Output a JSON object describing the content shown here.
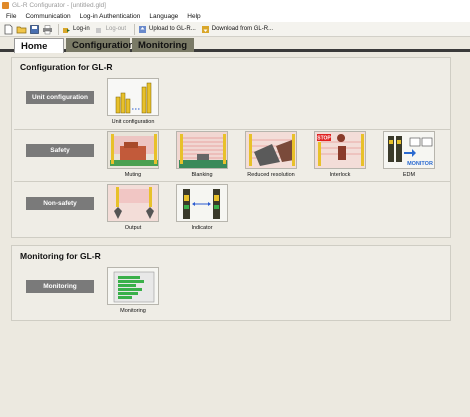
{
  "window": {
    "title": "GL-R Configurator - [untitled.gld]"
  },
  "menu": [
    "File",
    "Communication",
    "Log-in Authentication",
    "Language",
    "Help"
  ],
  "toolbar": {
    "login": "Log-in",
    "logout": "Log-out",
    "upload": "Upload to GL-R...",
    "download": "Download from GL-R..."
  },
  "tabs": [
    "Home",
    "Configuration",
    "Monitoring"
  ],
  "config_section": {
    "title": "Configuration for GL-R",
    "unit_configuration": {
      "label": "Unit configuration",
      "items": [
        "Unit configuration"
      ]
    },
    "safety": {
      "label": "Safety",
      "items": [
        "Muting",
        "Blanking",
        "Reduced resolution",
        "Interlock",
        "EDM"
      ]
    },
    "non_safety": {
      "label": "Non-safety",
      "items": [
        "Output",
        "Indicator"
      ]
    }
  },
  "monitoring_section": {
    "title": "Monitoring for GL-R",
    "monitoring": {
      "label": "Monitoring",
      "items": [
        "Monitoring"
      ]
    }
  },
  "icon_text": {
    "stop": "STOP",
    "monitor": "MONITOR"
  },
  "colors": {
    "category_button": "#7a7a7a",
    "tab_active_underline": "#3a3a3a",
    "sensor_yellow": "#e8c12a",
    "beam_red": "#d84a4a"
  }
}
